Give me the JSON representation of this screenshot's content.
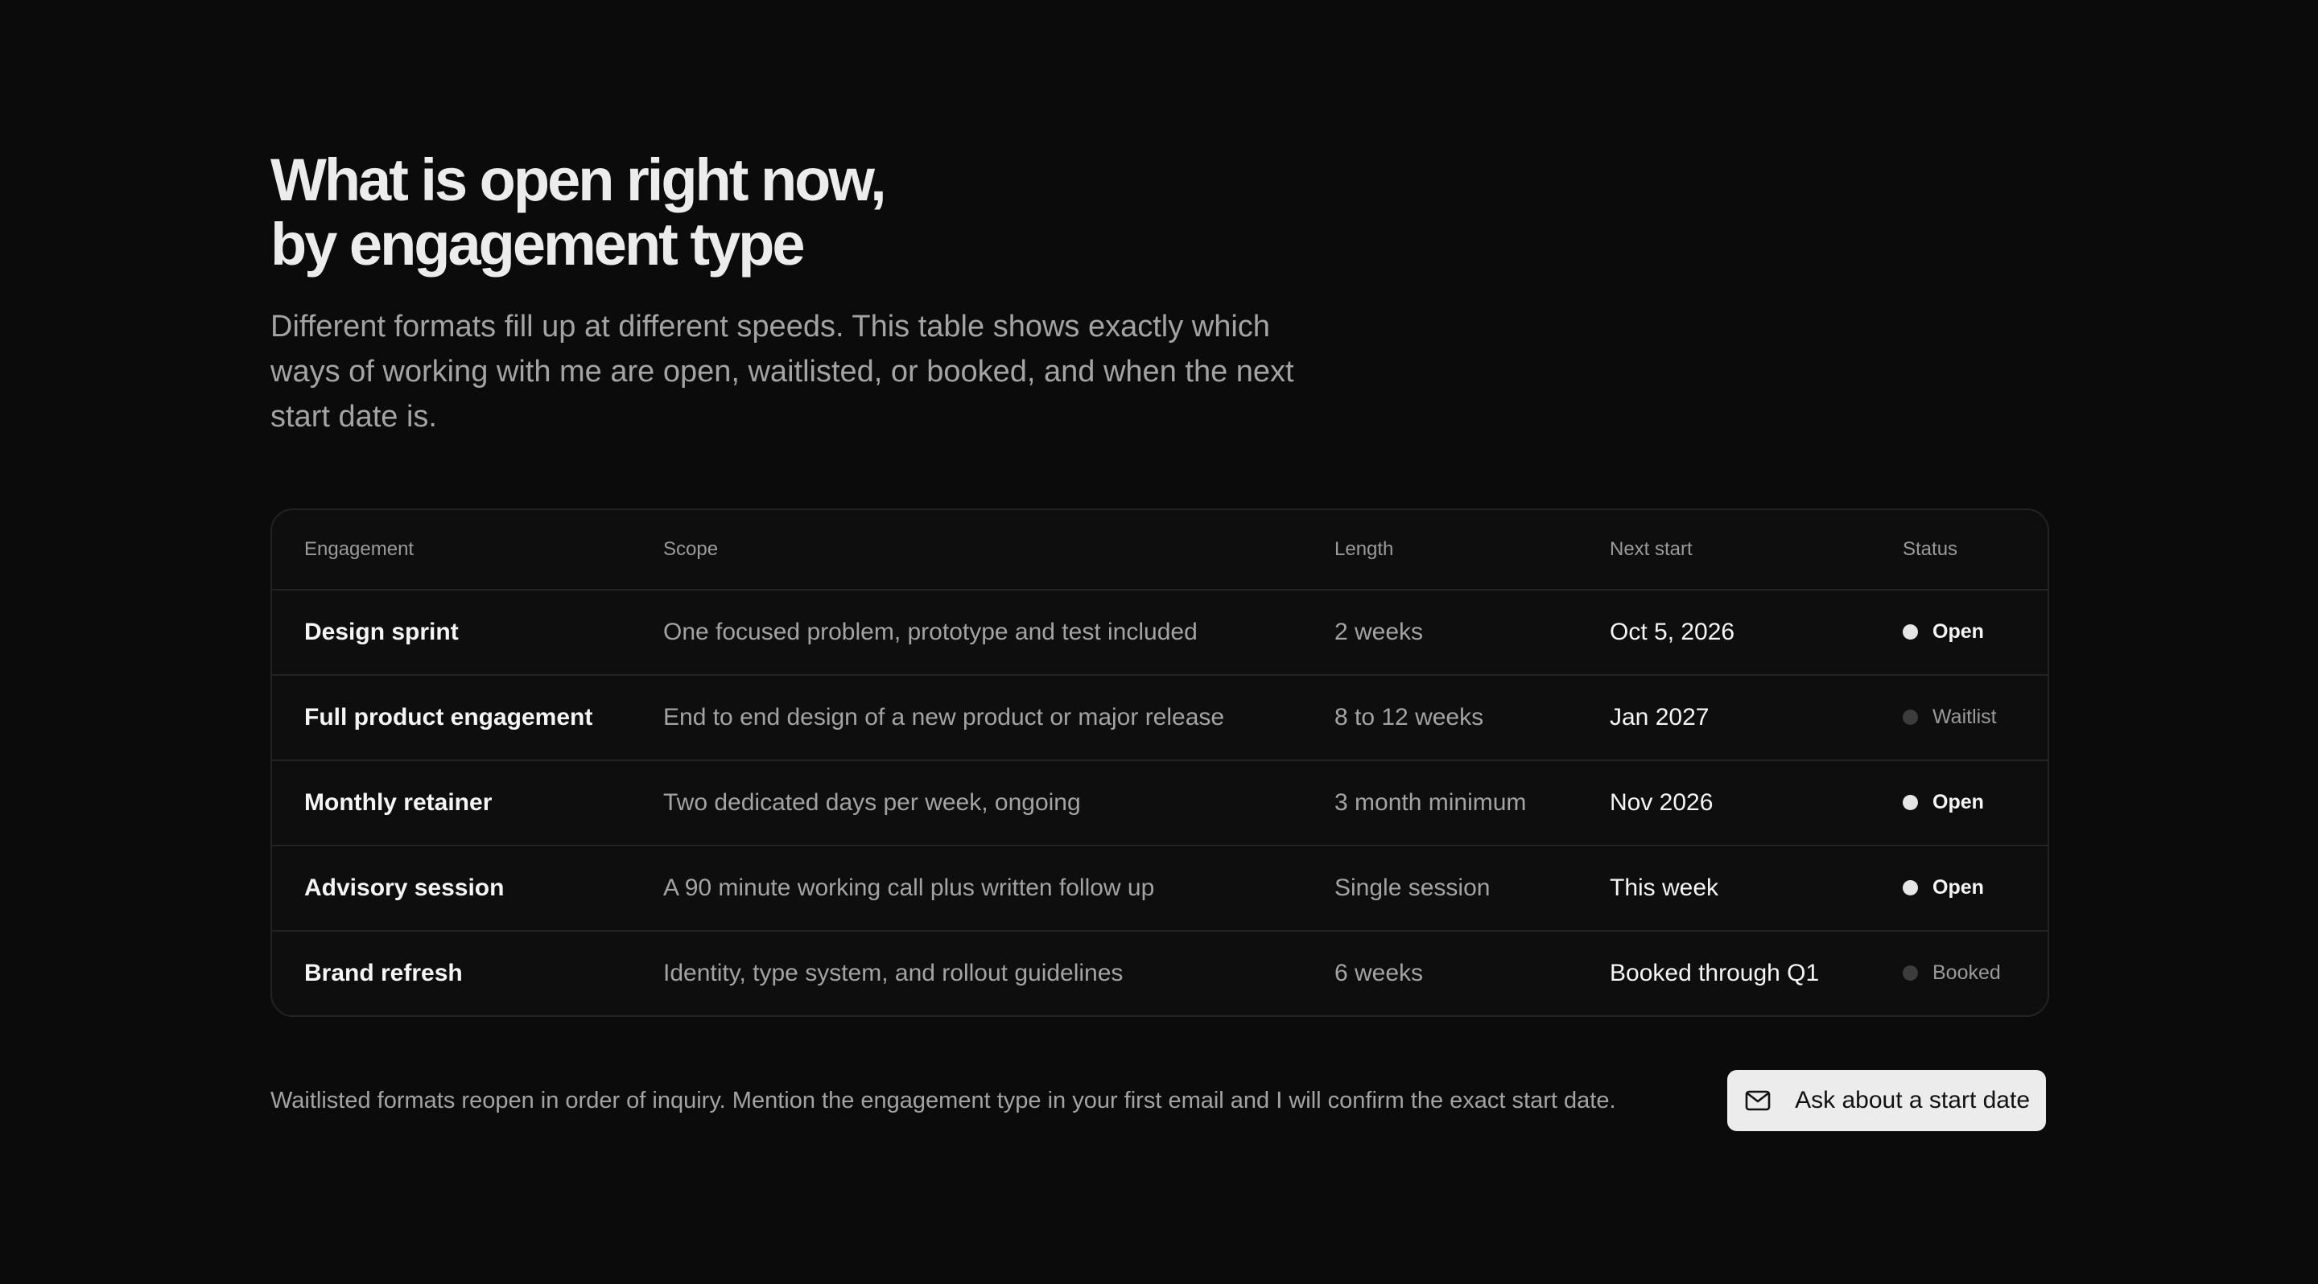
{
  "header": {
    "title_line1": "What is open right now,",
    "title_line2": "by engagement type",
    "lead": "Different formats fill up at different speeds. This table shows exactly which ways of working with me are open, waitlisted, or booked, and when the next start date is."
  },
  "table": {
    "columns": [
      "Engagement",
      "Scope",
      "Length",
      "Next start",
      "Status"
    ],
    "rows": [
      {
        "engagement": "Design sprint",
        "scope": "One focused problem, prototype and test included",
        "length": "2 weeks",
        "next_start": "Oct 5, 2026",
        "status": "Open"
      },
      {
        "engagement": "Full product engagement",
        "scope": "End to end design of a new product or major release",
        "length": "8 to 12 weeks",
        "next_start": "Jan 2027",
        "status": "Waitlist"
      },
      {
        "engagement": "Monthly retainer",
        "scope": "Two dedicated days per week, ongoing",
        "length": "3 month minimum",
        "next_start": "Nov 2026",
        "status": "Open"
      },
      {
        "engagement": "Advisory session",
        "scope": "A 90 minute working call plus written follow up",
        "length": "Single session",
        "next_start": "This week",
        "status": "Open"
      },
      {
        "engagement": "Brand refresh",
        "scope": "Identity, type system, and rollout guidelines",
        "length": "6 weeks",
        "next_start": "Booked through Q1",
        "status": "Booked"
      }
    ]
  },
  "footer": {
    "note": "Waitlisted formats reopen in order of inquiry. Mention the engagement type in your first email and I will confirm the exact start date.",
    "cta_label": "Ask about a start date",
    "cta_icon": "mail-icon"
  },
  "colors": {
    "background": "#0b0b0b",
    "open_dot": "#e6e6e6",
    "muted_dot": "#3c3c3c",
    "button_bg": "#ececec"
  }
}
